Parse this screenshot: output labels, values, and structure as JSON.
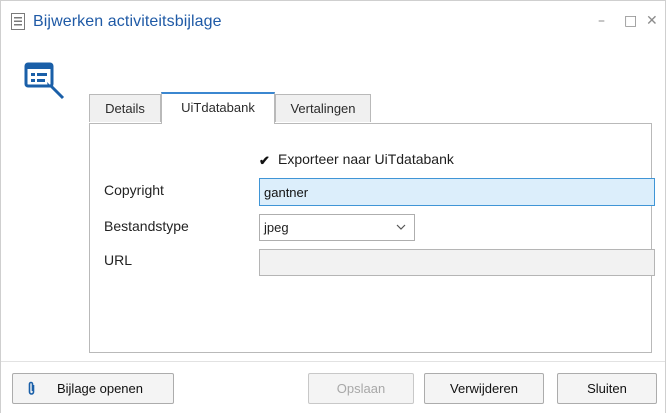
{
  "window": {
    "title": "Bijwerken activiteitsbijlage",
    "controls": {
      "minimize": "–",
      "maximize": "□",
      "close": "✕"
    }
  },
  "tabs": [
    {
      "label": "Details",
      "active": false
    },
    {
      "label": "UiTdatabank",
      "active": true
    },
    {
      "label": "Vertalingen",
      "active": false
    }
  ],
  "form": {
    "export_checkbox": {
      "label": "Exporteer naar UiTdatabank",
      "checked": true
    },
    "copyright": {
      "label": "Copyright",
      "value": "gantner"
    },
    "file_type": {
      "label": "Bestandstype",
      "value": "jpeg"
    },
    "url": {
      "label": "URL",
      "value": ""
    }
  },
  "buttons": {
    "open_attachment": "Bijlage openen",
    "save": "Opslaan",
    "delete": "Verwijderen",
    "close": "Sluiten"
  },
  "icons": {
    "window_icon": "document-form-icon",
    "dialog_icon": "form-edit-icon",
    "attachment_icon": "paperclip-icon",
    "dropdown_icon": "chevron-down-icon"
  },
  "colors": {
    "title": "#1f5aa6",
    "accent": "#3b87d0",
    "input_focus_bg": "#dceefb",
    "icon_blue": "#1a5fa8"
  }
}
